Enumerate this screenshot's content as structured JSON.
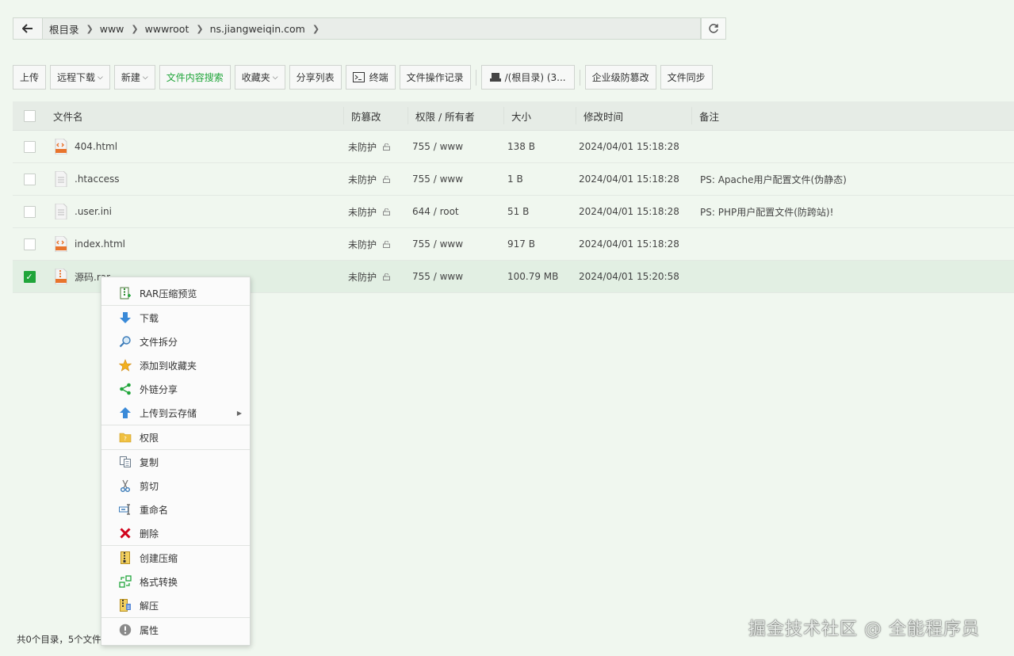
{
  "breadcrumb": {
    "items": [
      "根目录",
      "www",
      "wwwroot",
      "ns.jiangweiqin.com"
    ]
  },
  "toolbar": {
    "upload": "上传",
    "remote_download": "远程下载",
    "new": "新建",
    "content_search": "文件内容搜索",
    "favorites": "收藏夹",
    "share_list": "分享列表",
    "terminal": "终端",
    "op_log": "文件操作记录",
    "disk": "/(根目录) (3...",
    "tamper_proof": "企业级防篡改",
    "file_sync": "文件同步"
  },
  "table": {
    "headers": {
      "name": "文件名",
      "protect": "防篡改",
      "perm": "权限 / 所有者",
      "size": "大小",
      "mtime": "修改时间",
      "note": "备注"
    },
    "rows": [
      {
        "name": "404.html",
        "protect": "未防护",
        "perm": "755 / www",
        "size": "138 B",
        "mtime": "2024/04/01 15:18:28",
        "note": "",
        "icon": "html-file-icon"
      },
      {
        "name": ".htaccess",
        "protect": "未防护",
        "perm": "755 / www",
        "size": "1 B",
        "mtime": "2024/04/01 15:18:28",
        "note": "PS: Apache用户配置文件(伪静态)",
        "icon": "text-file-icon"
      },
      {
        "name": ".user.ini",
        "protect": "未防护",
        "perm": "644 / root",
        "size": "51 B",
        "mtime": "2024/04/01 15:18:28",
        "note": "PS: PHP用户配置文件(防跨站)!",
        "icon": "text-file-icon"
      },
      {
        "name": "index.html",
        "protect": "未防护",
        "perm": "755 / www",
        "size": "917 B",
        "mtime": "2024/04/01 15:18:28",
        "note": "",
        "icon": "html-file-icon"
      },
      {
        "name": "源码.rar",
        "protect": "未防护",
        "perm": "755 / www",
        "size": "100.79 MB",
        "mtime": "2024/04/01 15:20:58",
        "note": "",
        "icon": "rar-file-icon"
      }
    ]
  },
  "context_menu": {
    "items": [
      "RAR压缩预览",
      "下载",
      "文件拆分",
      "添加到收藏夹",
      "外链分享",
      "上传到云存储",
      "权限",
      "复制",
      "剪切",
      "重命名",
      "删除",
      "创建压缩",
      "格式转换",
      "解压",
      "属性"
    ]
  },
  "footer": {
    "summary": "共0个目录，5个文件"
  },
  "watermark": "掘金技术社区 @ 全能程序员",
  "colors": {
    "accent": "#20a53a",
    "delete": "#d0021b",
    "background": "#f0f7ef"
  }
}
